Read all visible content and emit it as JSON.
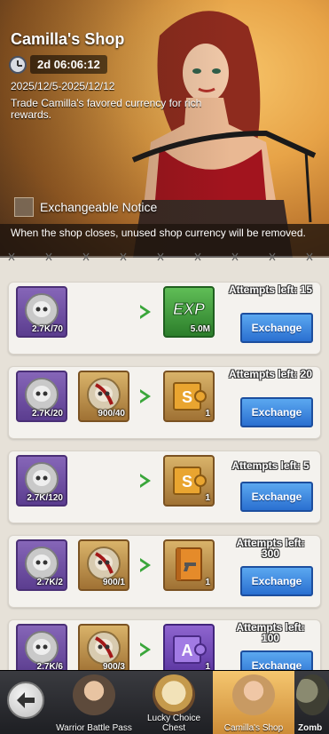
{
  "header": {
    "title": "Camilla's Shop",
    "timer": "2d 06:06:12",
    "dates": "2025/12/5-2025/12/12",
    "description": "Trade Camilla's favored currency for rich rewards.",
    "notice_label": "Exchangeable Notice",
    "notice_text": "When the shop closes, unused shop currency will be removed."
  },
  "rows": [
    {
      "cost_1": "2.7K/70",
      "reward": "5.0M",
      "reward_type": "exp",
      "attempts": "Attempts left: 15",
      "button": "Exchange"
    },
    {
      "cost_1": "2.7K/20",
      "cost_2": "900/40",
      "reward": "1",
      "reward_type": "gold-puzzle",
      "attempts": "Attempts left: 20",
      "button": "Exchange"
    },
    {
      "cost_1": "2.7K/120",
      "reward": "1",
      "reward_type": "gold-puzzle",
      "attempts": "Attempts left: 5",
      "button": "Exchange"
    },
    {
      "cost_1": "2.7K/2",
      "cost_2": "900/1",
      "reward": "1",
      "reward_type": "manual",
      "attempts": "Attempts left: 300",
      "button": "Exchange"
    },
    {
      "cost_1": "2.7K/6",
      "cost_2": "900/3",
      "reward": "1",
      "reward_type": "purple-puzzle",
      "attempts": "Attempts left: 100",
      "button": "Exchange"
    }
  ],
  "bottom_tabs": [
    {
      "label": "Warrior Battle Pass"
    },
    {
      "label": "Lucky Choice Chest"
    },
    {
      "label": "Camilla's Shop",
      "active": true
    },
    {
      "label": "Zomb"
    }
  ],
  "icons": {
    "back": "back-arrow-icon",
    "clock": "clock-icon",
    "skull_token": "skull-token-icon",
    "bloody_token": "bloody-skull-token-icon",
    "exp": "exp-icon"
  },
  "colors": {
    "button_blue": "#2a6fd0",
    "arrow_green": "#3aa63a",
    "active_tab": "#f5c66f"
  }
}
